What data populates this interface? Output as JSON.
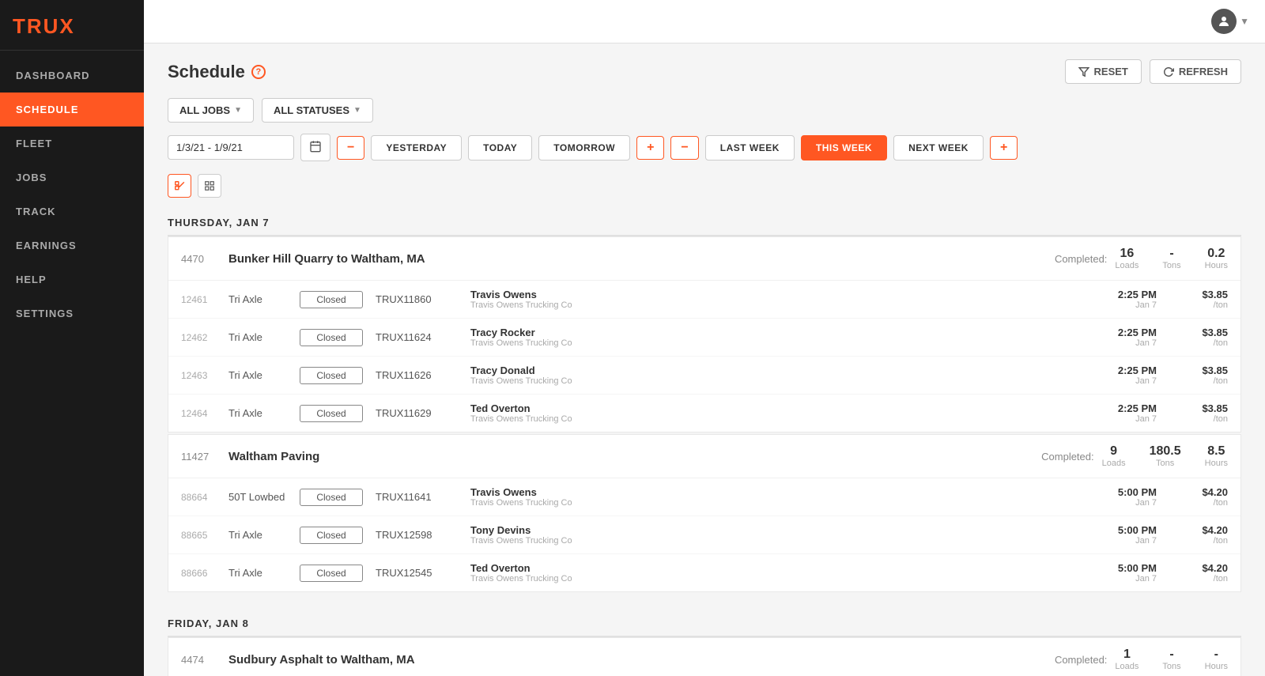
{
  "app": {
    "logo": "TRUX",
    "toggle_icon": "◀"
  },
  "sidebar": {
    "items": [
      {
        "id": "dashboard",
        "label": "DASHBOARD",
        "active": false
      },
      {
        "id": "schedule",
        "label": "SCHEDULE",
        "active": true
      },
      {
        "id": "fleet",
        "label": "FLEET",
        "active": false
      },
      {
        "id": "jobs",
        "label": "JOBS",
        "active": false
      },
      {
        "id": "track",
        "label": "TRACK",
        "active": false
      },
      {
        "id": "earnings",
        "label": "EARNINGS",
        "active": false
      },
      {
        "id": "help",
        "label": "HELP",
        "active": false
      },
      {
        "id": "settings",
        "label": "SETTINGS",
        "active": false
      }
    ]
  },
  "page": {
    "title": "Schedule",
    "help_icon": "?",
    "reset_label": "RESET",
    "refresh_label": "REFRESH"
  },
  "filters": {
    "jobs_label": "ALL JOBS",
    "statuses_label": "ALL STATUSES"
  },
  "nav": {
    "date_range": "1/3/21 - 1/9/21",
    "yesterday": "YESTERDAY",
    "today": "TODAY",
    "tomorrow": "TOMORROW",
    "last_week": "LAST WEEK",
    "this_week": "THIS WEEK",
    "next_week": "NEXT WEEK"
  },
  "days": [
    {
      "label": "THURSDAY, JAN 7",
      "jobs": [
        {
          "id": "4470",
          "name": "Bunker Hill Quarry to Waltham, MA",
          "completed_label": "Completed:",
          "stats": [
            {
              "value": "16",
              "label": "Loads"
            },
            {
              "value": "-",
              "label": "Tons"
            },
            {
              "value": "0.2",
              "label": "Hours"
            }
          ],
          "assignments": [
            {
              "id": "12461",
              "type": "Tri Axle",
              "status": "Closed",
              "truck": "TRUX11860",
              "driver_name": "Travis Owens",
              "driver_company": "Travis Owens Trucking Co",
              "time": "2:25 PM",
              "date": "Jan 7",
              "rate": "$3.85",
              "rate_unit": "/ton"
            },
            {
              "id": "12462",
              "type": "Tri Axle",
              "status": "Closed",
              "truck": "TRUX11624",
              "driver_name": "Tracy Rocker",
              "driver_company": "Travis Owens Trucking Co",
              "time": "2:25 PM",
              "date": "Jan 7",
              "rate": "$3.85",
              "rate_unit": "/ton"
            },
            {
              "id": "12463",
              "type": "Tri Axle",
              "status": "Closed",
              "truck": "TRUX11626",
              "driver_name": "Tracy Donald",
              "driver_company": "Travis Owens Trucking Co",
              "time": "2:25 PM",
              "date": "Jan 7",
              "rate": "$3.85",
              "rate_unit": "/ton"
            },
            {
              "id": "12464",
              "type": "Tri Axle",
              "status": "Closed",
              "truck": "TRUX11629",
              "driver_name": "Ted Overton",
              "driver_company": "Travis Owens Trucking Co",
              "time": "2:25 PM",
              "date": "Jan 7",
              "rate": "$3.85",
              "rate_unit": "/ton"
            }
          ]
        },
        {
          "id": "11427",
          "name": "Waltham Paving",
          "completed_label": "Completed:",
          "stats": [
            {
              "value": "9",
              "label": "Loads"
            },
            {
              "value": "180.5",
              "label": "Tons"
            },
            {
              "value": "8.5",
              "label": "Hours"
            }
          ],
          "assignments": [
            {
              "id": "88664",
              "type": "50T Lowbed",
              "status": "Closed",
              "truck": "TRUX11641",
              "driver_name": "Travis Owens",
              "driver_company": "Travis Owens Trucking Co",
              "time": "5:00 PM",
              "date": "Jan 7",
              "rate": "$4.20",
              "rate_unit": "/ton"
            },
            {
              "id": "88665",
              "type": "Tri Axle",
              "status": "Closed",
              "truck": "TRUX12598",
              "driver_name": "Tony Devins",
              "driver_company": "Travis Owens Trucking Co",
              "time": "5:00 PM",
              "date": "Jan 7",
              "rate": "$4.20",
              "rate_unit": "/ton"
            },
            {
              "id": "88666",
              "type": "Tri Axle",
              "status": "Closed",
              "truck": "TRUX12545",
              "driver_name": "Ted Overton",
              "driver_company": "Travis Owens Trucking Co",
              "time": "5:00 PM",
              "date": "Jan 7",
              "rate": "$4.20",
              "rate_unit": "/ton"
            }
          ]
        }
      ]
    },
    {
      "label": "FRIDAY, JAN 8",
      "jobs": [
        {
          "id": "4474",
          "name": "Sudbury Asphalt to Waltham, MA",
          "completed_label": "Completed:",
          "stats": [
            {
              "value": "1",
              "label": "Loads"
            },
            {
              "value": "-",
              "label": "Tons"
            },
            {
              "value": "-",
              "label": "Hours"
            }
          ],
          "assignments": []
        }
      ]
    }
  ],
  "colors": {
    "brand_orange": "#ff5722",
    "sidebar_bg": "#1a1a1a",
    "active_nav": "#ff5722"
  }
}
